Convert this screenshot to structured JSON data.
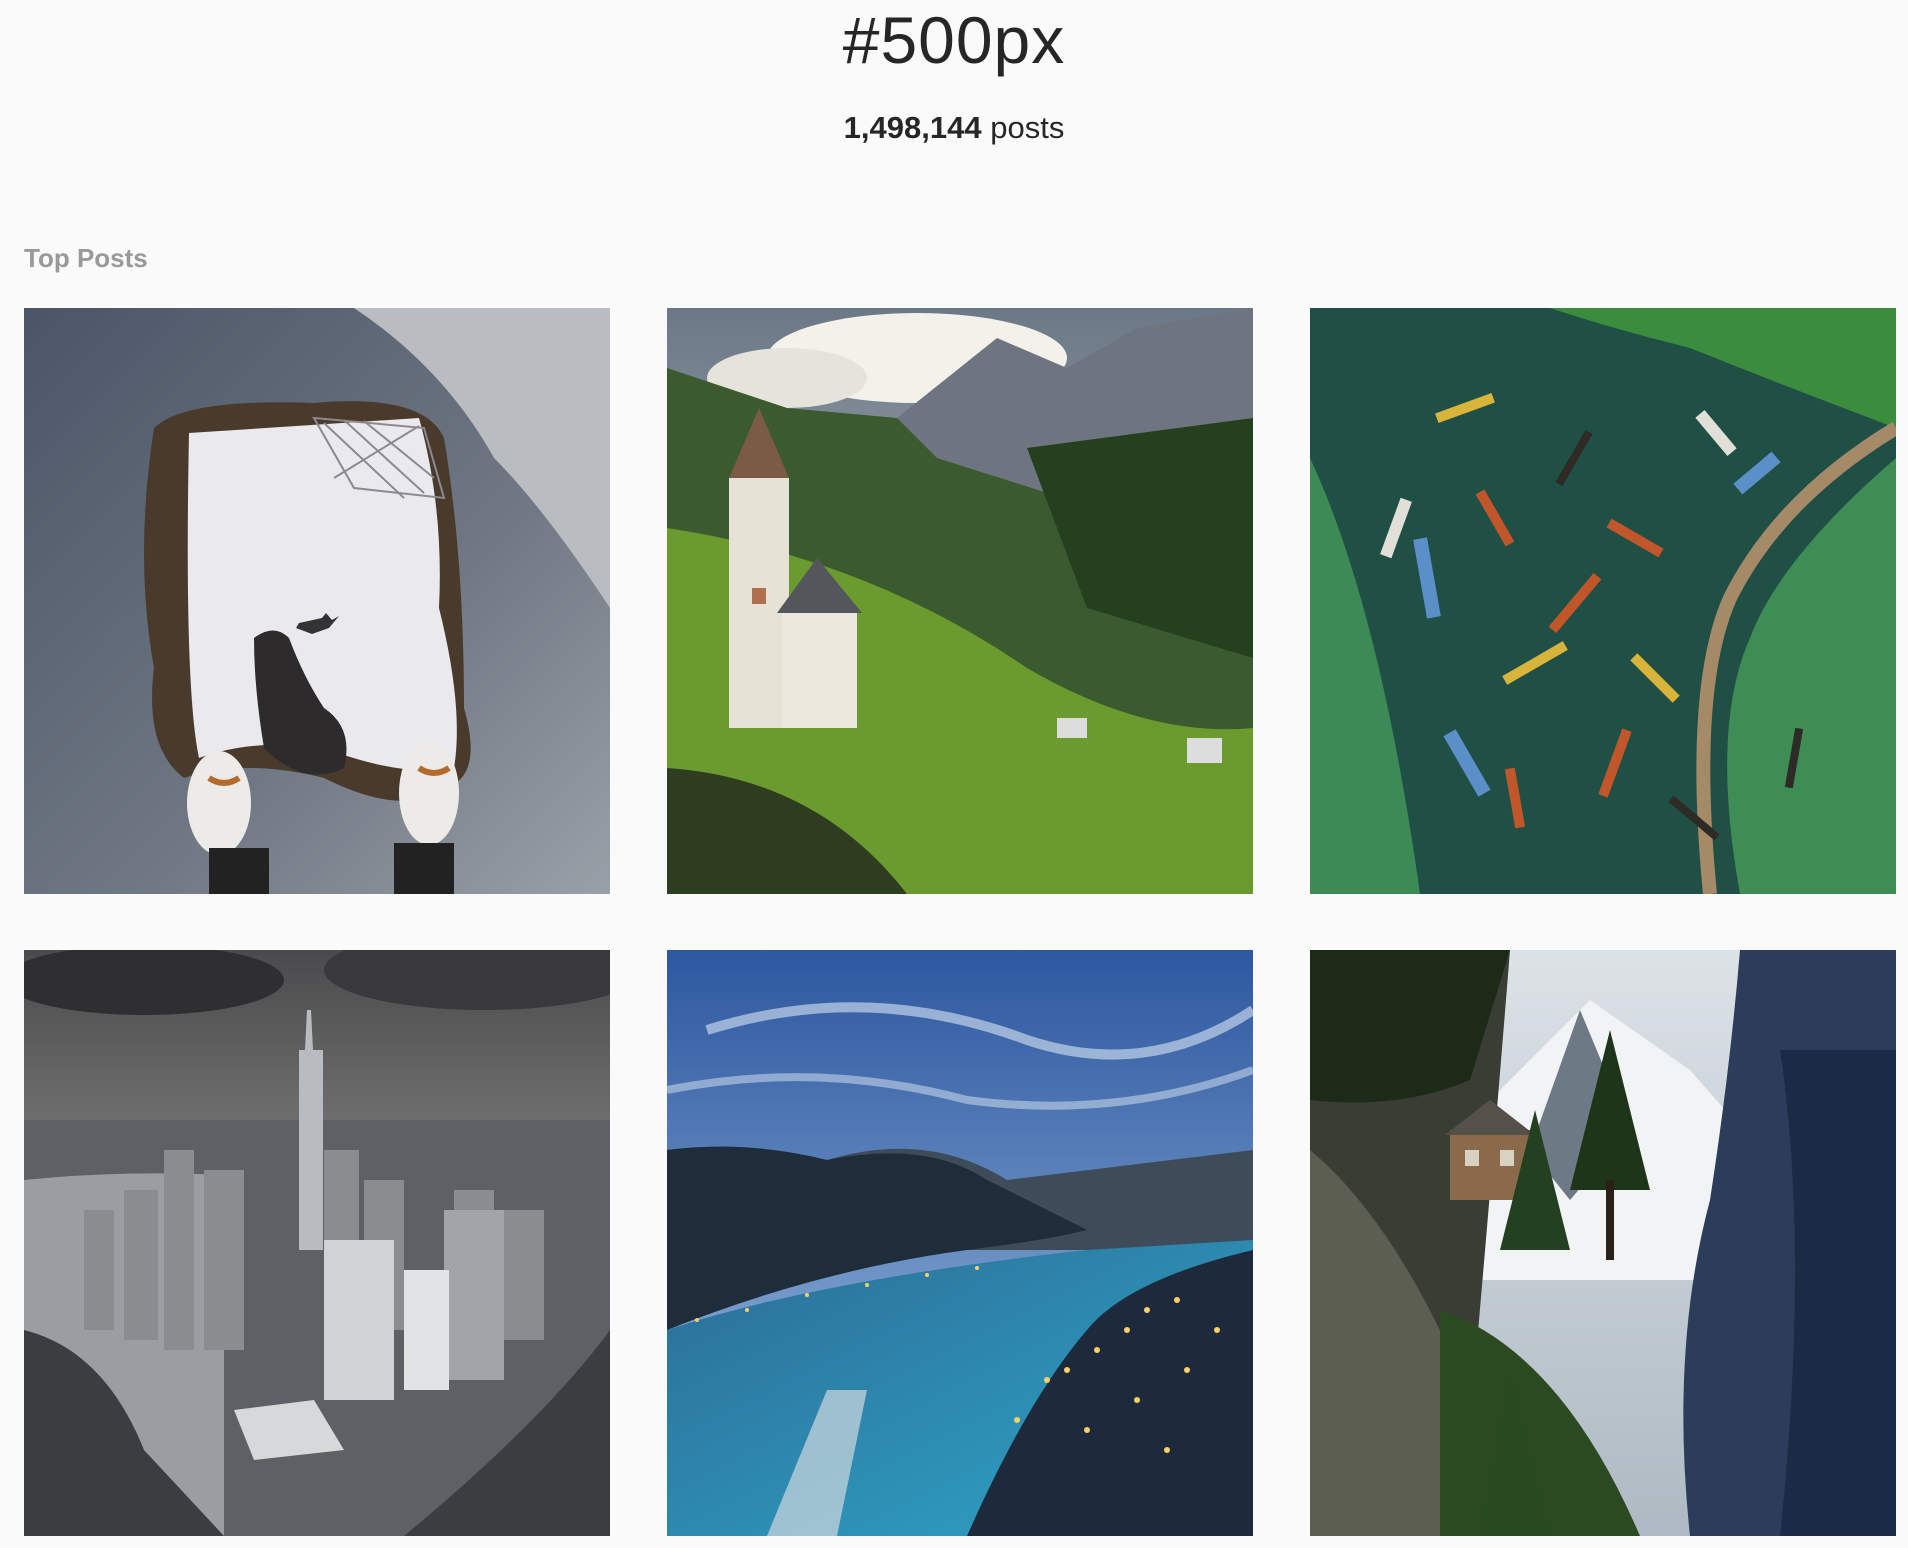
{
  "header": {
    "hashtag": "#500px",
    "post_count": "1,498,144",
    "post_count_suffix": "posts"
  },
  "section": {
    "label": "Top Posts"
  },
  "posts": [
    {
      "subject": "puddle reflection with airplane and shoes"
    },
    {
      "subject": "alpine church above green valley with mountains"
    },
    {
      "subject": "aerial view of boats on green water with boardwalk"
    },
    {
      "subject": "aerial view of city skyline with skyscrapers"
    },
    {
      "subject": "bay with town lights at dusk under blue sky"
    },
    {
      "subject": "cliffside house among pine trees with snowy peak"
    }
  ]
}
